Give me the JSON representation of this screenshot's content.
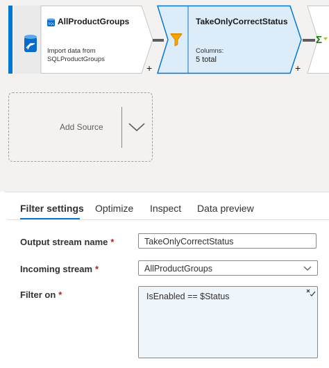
{
  "canvas": {
    "source_node": {
      "title": "AllProductGroups",
      "description_line1": "Import data from",
      "description_line2": "SQLProductGroups",
      "add_label": "+"
    },
    "filter_node": {
      "title": "TakeOnlyCorrectStatus",
      "columns_label": "Columns:",
      "columns_value": "5 total",
      "add_label": "+"
    },
    "add_source": {
      "label": "Add Source"
    }
  },
  "tabs": [
    {
      "label": "Filter settings",
      "active": true
    },
    {
      "label": "Optimize",
      "active": false
    },
    {
      "label": "Inspect",
      "active": false
    },
    {
      "label": "Data preview",
      "active": false
    }
  ],
  "form": {
    "output_stream": {
      "label": "Output stream name",
      "required": "*",
      "value": "TakeOnlyCorrectStatus"
    },
    "incoming_stream": {
      "label": "Incoming stream",
      "required": "*",
      "value": "AllProductGroups"
    },
    "filter_on": {
      "label": "Filter on",
      "required": "*",
      "expression": "IsEnabled == $Status"
    }
  },
  "colors": {
    "accent": "#0078d4",
    "selected_node": "#dcecf8",
    "filter_icon": "#f7a600"
  },
  "icons": [
    "sql-source-icon",
    "database-icon",
    "funnel-icon",
    "aggregate-icon",
    "chevron-down-icon",
    "expression-builder-icon"
  ]
}
